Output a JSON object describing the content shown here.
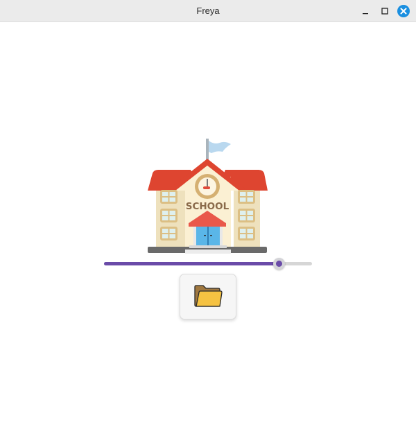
{
  "window": {
    "title": "Freya",
    "controls": [
      "minimize-icon",
      "maximize-icon",
      "close-icon"
    ],
    "close_color": "#1a8fe0"
  },
  "illustration": {
    "icon": "school-building-icon",
    "sign_text": "SCHOOL"
  },
  "slider": {
    "value": 0.84,
    "accent_color": "#6a4ba8"
  },
  "open_button": {
    "icon": "folder-icon"
  }
}
